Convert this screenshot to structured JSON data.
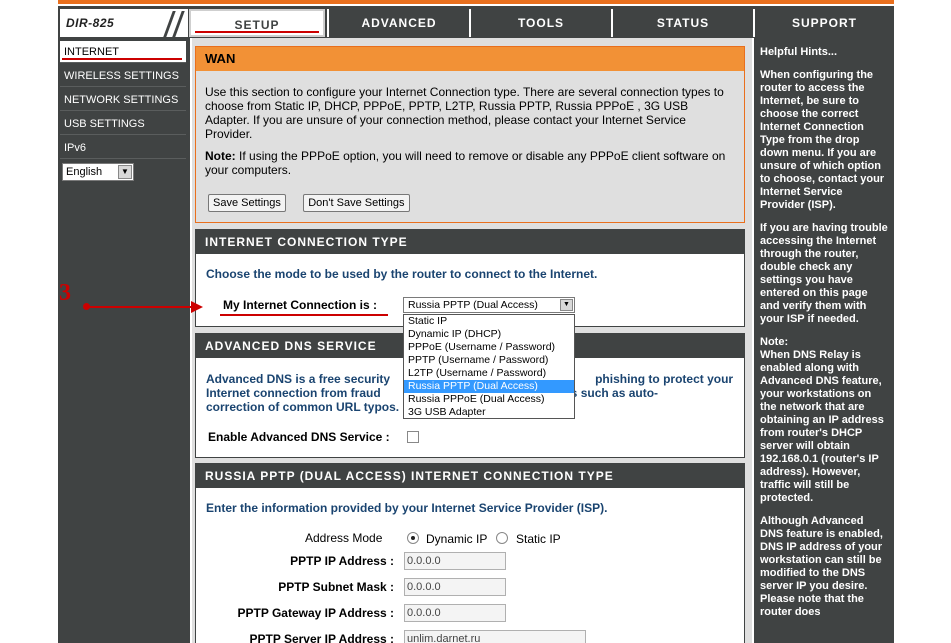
{
  "model": "DIR-825",
  "tabs": [
    {
      "label": "SETUP",
      "active": true
    },
    {
      "label": "ADVANCED",
      "active": false
    },
    {
      "label": "TOOLS",
      "active": false
    },
    {
      "label": "STATUS",
      "active": false
    },
    {
      "label": "SUPPORT",
      "active": false
    }
  ],
  "nav": [
    {
      "label": "INTERNET",
      "active": true
    },
    {
      "label": "WIRELESS SETTINGS",
      "active": false
    },
    {
      "label": "NETWORK SETTINGS",
      "active": false
    },
    {
      "label": "USB SETTINGS",
      "active": false
    },
    {
      "label": "IPv6",
      "active": false
    }
  ],
  "language": "English",
  "wan": {
    "title": "WAN",
    "intro": "Use this section to configure your Internet Connection type. There are several connection types to choose from Static IP, DHCP, PPPoE, PPTP, L2TP, Russia PPTP, Russia PPPoE , 3G USB Adapter. If you are unsure of your connection method, please contact your Internet Service Provider.",
    "note_label": "Note:",
    "note_text": "If using the PPPoE option, you will need to remove or disable any PPPoE client software on your computers.",
    "save_label": "Save Settings",
    "dont_save_label": "Don't Save Settings"
  },
  "ict": {
    "title": "INTERNET CONNECTION TYPE",
    "prompt": "Choose the mode to be used by the router to connect to the Internet.",
    "label": "My Internet Connection is :",
    "selected": "Russia PPTP (Dual Access)",
    "options": [
      "Static IP",
      "Dynamic IP (DHCP)",
      "PPPoE (Username / Password)",
      "PPTP (Username / Password)",
      "L2TP (Username / Password)",
      "Russia PPTP (Dual Access)",
      "Russia PPPoE (Dual Access)",
      "3G USB Adapter"
    ]
  },
  "dns": {
    "title": "ADVANCED DNS SERVICE",
    "line1_left": "Advanced DNS is a free security",
    "line1_right": "phishing to protect your",
    "line2_left": "Internet connection from fraud",
    "line2_right": "ts such as auto-",
    "line3": "correction of common URL typos.",
    "enable_label": "Enable Advanced DNS Service :"
  },
  "pptp": {
    "title": "RUSSIA PPTP (DUAL ACCESS) INTERNET CONNECTION TYPE",
    "prompt": "Enter the information provided by your Internet Service Provider (ISP).",
    "address_mode_label": "Address Mode",
    "dynamic_label": "Dynamic IP",
    "static_label": "Static IP",
    "ip_label": "PPTP IP Address :",
    "ip_value": "0.0.0.0",
    "mask_label": "PPTP Subnet Mask :",
    "mask_value": "0.0.0.0",
    "gw_label": "PPTP Gateway IP Address :",
    "gw_value": "0.0.0.0",
    "server_label": "PPTP Server IP Address :",
    "server_value": "unlim.darnet.ru"
  },
  "hints": {
    "title": "Helpful Hints...",
    "p1": "When configuring the router to access the Internet, be sure to choose the correct Internet Connection Type from the drop down menu. If you are unsure of which option to choose, contact your Internet Service Provider (ISP).",
    "p2": "If you are having trouble accessing the Internet through the router, double check any settings you have entered on this page and verify them with your ISP if needed.",
    "p3": "Note:\nWhen DNS Relay is enabled along with Advanced DNS feature, your workstations on the network that are obtaining an IP address from router's DHCP server will obtain 192.168.0.1 (router's IP address). However, traffic will still be protected.",
    "p4": "Although Advanced DNS feature is enabled, DNS IP address of your workstation can still be modified to the DNS server IP you desire. Please note that the router does"
  },
  "annotation": {
    "number": "3",
    "color": "#cc0000"
  },
  "colors": {
    "dark": "#404343",
    "orange": "#e96f1d",
    "blue_text": "#1a4470",
    "selection": "#3399ff"
  }
}
